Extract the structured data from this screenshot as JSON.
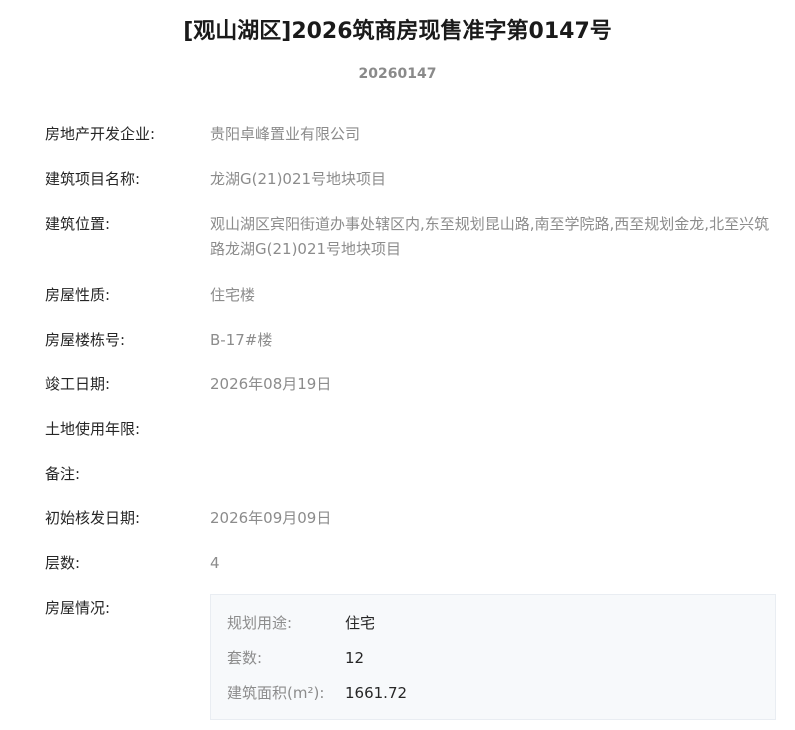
{
  "header": {
    "title": "[观山湖区]2026筑商房现售准字第0147号",
    "number": "20260147"
  },
  "fields": [
    {
      "label": "房地产开发企业:",
      "value": "贵阳卓峰置业有限公司"
    },
    {
      "label": "建筑项目名称:",
      "value": "龙湖G(21)021号地块项目"
    },
    {
      "label": "建筑位置:",
      "value": "观山湖区宾阳街道办事处辖区内,东至规划昆山路,南至学院路,西至规划金龙,北至兴筑路龙湖G(21)021号地块项目"
    },
    {
      "label": "房屋性质:",
      "value": "住宅楼"
    },
    {
      "label": "房屋楼栋号:",
      "value": "B-17#楼"
    },
    {
      "label": "竣工日期:",
      "value": "2026年08月19日"
    },
    {
      "label": "土地使用年限:",
      "value": ""
    },
    {
      "label": "备注:",
      "value": ""
    },
    {
      "label": "初始核发日期:",
      "value": "2026年09月09日"
    },
    {
      "label": "层数:",
      "value": "4"
    }
  ],
  "house_info": {
    "label": "房屋情况:",
    "rows": [
      {
        "label": "规划用途:",
        "value": "住宅"
      },
      {
        "label": "套数:",
        "value": "12"
      },
      {
        "label": "建筑面积(m²):",
        "value": "1661.72"
      }
    ]
  }
}
